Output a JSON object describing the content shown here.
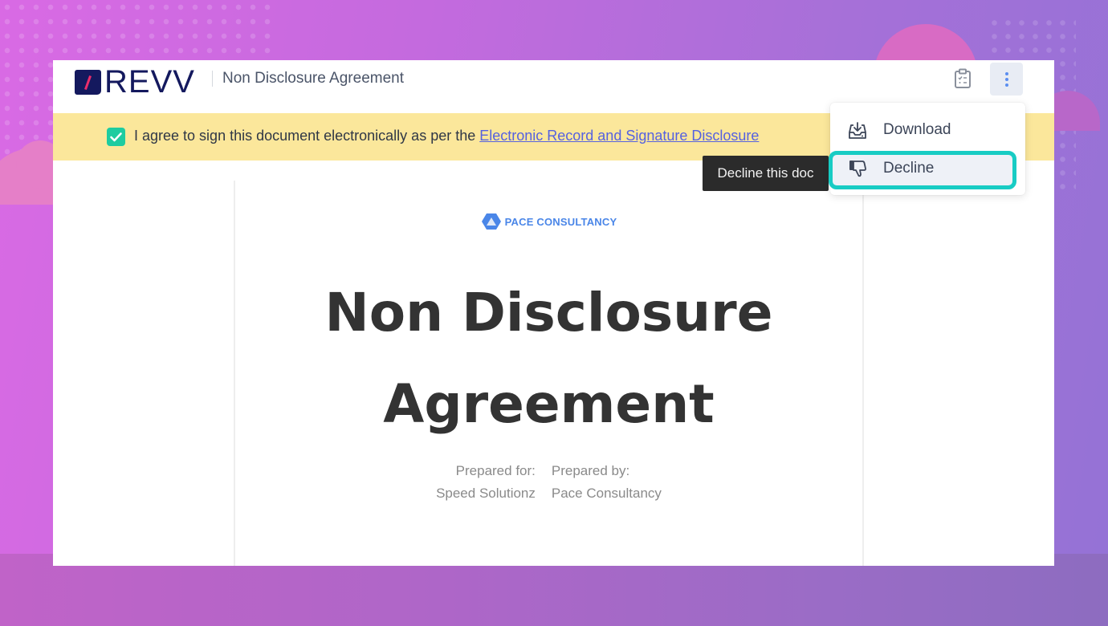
{
  "app": {
    "brand": "REVV",
    "document_title": "Non Disclosure Agreement"
  },
  "header": {
    "icons": {
      "checklist": "clipboard-checklist-icon",
      "more": "more-vertical-icon"
    }
  },
  "consent": {
    "checked": true,
    "text": "I agree to sign this document electronically as per the ",
    "link_text": "Electronic Record and Signature Disclosure"
  },
  "menu": {
    "items": [
      {
        "label": "Download",
        "icon": "download-tray-icon"
      },
      {
        "label": "Decline",
        "icon": "thumbs-down-icon",
        "highlighted": true
      }
    ]
  },
  "tooltip": {
    "text": "Decline this doc"
  },
  "document": {
    "company": "PACE CONSULTANCY",
    "title_line1": "Non Disclosure",
    "title_line2": "Agreement",
    "prepared_for_label": "Prepared for:",
    "prepared_for_value": "Speed Solutionz",
    "prepared_by_label": "Prepared by:",
    "prepared_by_value": "Pace Consultancy"
  },
  "colors": {
    "brand_navy": "#14195e",
    "brand_accent": "#ec2d6b",
    "consent_bg": "#fbe79b",
    "checkbox": "#1ecca0",
    "link": "#5561e0",
    "highlight_ring": "#18ccc4",
    "company_blue": "#4a86e8"
  }
}
